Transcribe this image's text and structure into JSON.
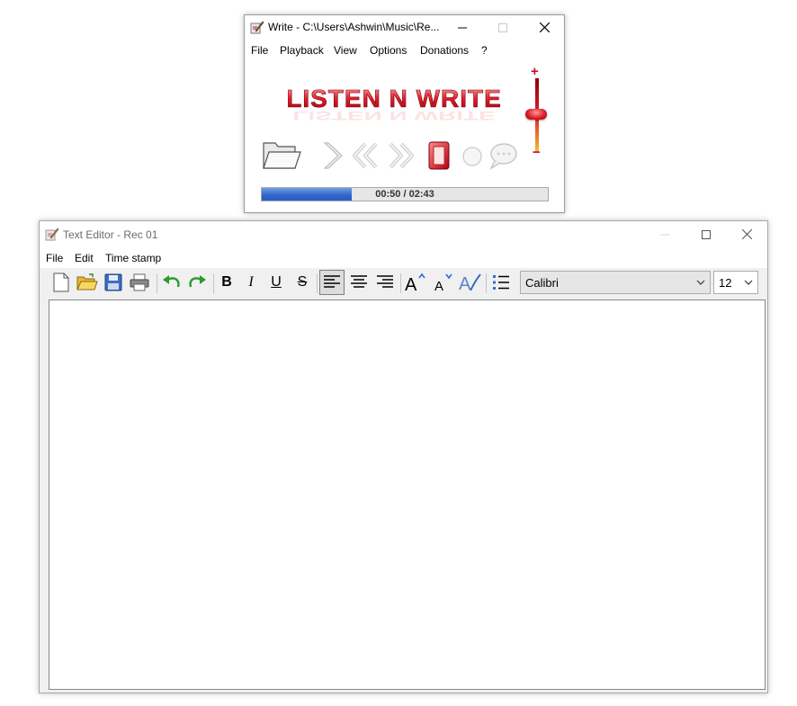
{
  "player": {
    "title": "Write - C:\\Users\\Ashwin\\Music\\Re...",
    "menu": [
      "File",
      "Playback",
      "View",
      "Options",
      "Donations",
      "?"
    ],
    "logo_text": "LISTEN N WRITE",
    "progress": {
      "fraction": 0.315,
      "label": "00:50 / 02:43"
    },
    "volume_fraction": 0.55,
    "controls": [
      "open-folder-icon",
      "play-icon",
      "rewind-icon",
      "fast-forward-icon",
      "record-icon",
      "circle-icon",
      "speech-bubble-icon"
    ]
  },
  "editor": {
    "title": "Text Editor - Rec 01",
    "menu": [
      "File",
      "Edit",
      "Time stamp"
    ],
    "format": {
      "bold": "B",
      "italic": "I",
      "underline": "U",
      "strike": "S"
    },
    "font": "Calibri",
    "size": "12",
    "toolbar_icons": [
      "new-document-icon",
      "open-folder-icon",
      "save-icon",
      "print-icon",
      "undo-icon",
      "redo-icon",
      "bold-icon",
      "italic-icon",
      "underline-icon",
      "strikethrough-icon",
      "align-left-icon",
      "align-center-icon",
      "align-right-icon",
      "grow-font-icon",
      "shrink-font-icon",
      "font-style-icon",
      "bullet-list-icon"
    ]
  },
  "colors": {
    "accent_red": "#c8102e",
    "progress_blue": "#2e63c9"
  }
}
